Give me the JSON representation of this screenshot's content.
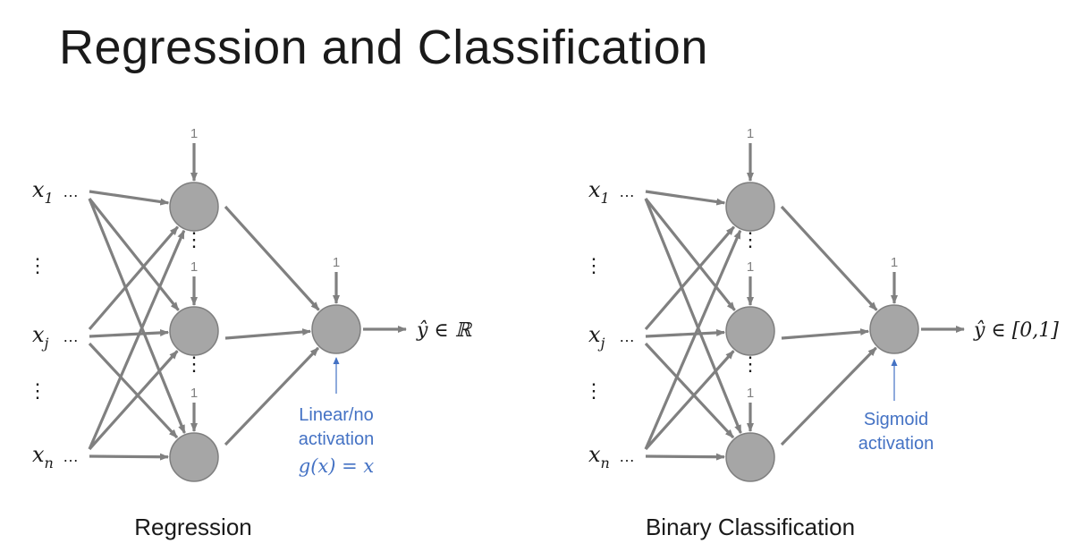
{
  "title": "Regression and Classification",
  "colors": {
    "arrow": "#808080",
    "node": "#a6a6a6",
    "node_stroke": "#7f7f7f",
    "annotation": "#4472c4",
    "bias": "#808080",
    "text": "#1a1a1a"
  },
  "panels": [
    {
      "id": "regression",
      "caption": "Regression",
      "inputs": [
        {
          "var": "x",
          "sub": "1",
          "dots": "…"
        },
        {
          "var": "x",
          "sub": "j",
          "dots": "…"
        },
        {
          "var": "x",
          "sub": "n",
          "dots": "…"
        }
      ],
      "input_vdots": "⋮",
      "hidden_vdots": "⋮",
      "bias_label": "1",
      "output_label": "ŷ ∈ ℝ",
      "annotation": {
        "line1": "Linear/no",
        "line2": "activation",
        "line3": "g(x) = x"
      }
    },
    {
      "id": "binary-classification",
      "caption": "Binary Classification",
      "inputs": [
        {
          "var": "x",
          "sub": "1",
          "dots": "…"
        },
        {
          "var": "x",
          "sub": "j",
          "dots": "…"
        },
        {
          "var": "x",
          "sub": "n",
          "dots": "…"
        }
      ],
      "input_vdots": "⋮",
      "hidden_vdots": "⋮",
      "bias_label": "1",
      "output_label": "ŷ ∈ [0,1]",
      "annotation": {
        "line1": "Sigmoid",
        "line2": "activation"
      }
    }
  ]
}
